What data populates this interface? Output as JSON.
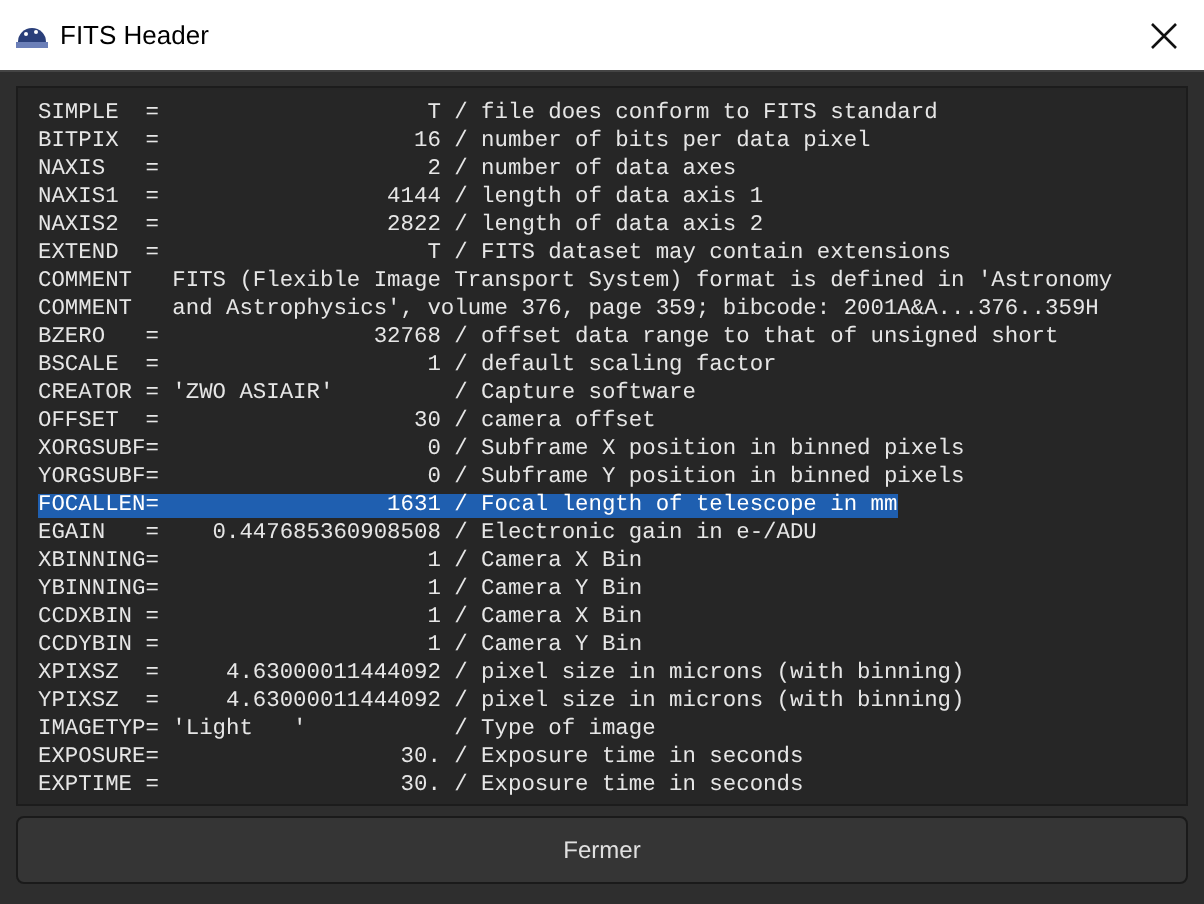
{
  "window": {
    "title": "FITS Header"
  },
  "lines": [
    {
      "text": "SIMPLE  =                    T / file does conform to FITS standard",
      "selected": false
    },
    {
      "text": "BITPIX  =                   16 / number of bits per data pixel",
      "selected": false
    },
    {
      "text": "NAXIS   =                    2 / number of data axes",
      "selected": false
    },
    {
      "text": "NAXIS1  =                 4144 / length of data axis 1",
      "selected": false
    },
    {
      "text": "NAXIS2  =                 2822 / length of data axis 2",
      "selected": false
    },
    {
      "text": "EXTEND  =                    T / FITS dataset may contain extensions",
      "selected": false
    },
    {
      "text": "COMMENT   FITS (Flexible Image Transport System) format is defined in 'Astronomy",
      "selected": false
    },
    {
      "text": "COMMENT   and Astrophysics', volume 376, page 359; bibcode: 2001A&A...376..359H",
      "selected": false
    },
    {
      "text": "BZERO   =                32768 / offset data range to that of unsigned short",
      "selected": false
    },
    {
      "text": "BSCALE  =                    1 / default scaling factor",
      "selected": false
    },
    {
      "text": "CREATOR = 'ZWO ASIAIR'         / Capture software",
      "selected": false
    },
    {
      "text": "OFFSET  =                   30 / camera offset",
      "selected": false
    },
    {
      "text": "XORGSUBF=                    0 / Subframe X position in binned pixels",
      "selected": false
    },
    {
      "text": "YORGSUBF=                    0 / Subframe Y position in binned pixels",
      "selected": false
    },
    {
      "text": "FOCALLEN=                 1631 / Focal length of telescope in mm",
      "selected": true
    },
    {
      "text": "EGAIN   =    0.447685360908508 / Electronic gain in e-/ADU",
      "selected": false
    },
    {
      "text": "XBINNING=                    1 / Camera X Bin",
      "selected": false
    },
    {
      "text": "YBINNING=                    1 / Camera Y Bin",
      "selected": false
    },
    {
      "text": "CCDXBIN =                    1 / Camera X Bin",
      "selected": false
    },
    {
      "text": "CCDYBIN =                    1 / Camera Y Bin",
      "selected": false
    },
    {
      "text": "XPIXSZ  =     4.63000011444092 / pixel size in microns (with binning)",
      "selected": false
    },
    {
      "text": "YPIXSZ  =     4.63000011444092 / pixel size in microns (with binning)",
      "selected": false
    },
    {
      "text": "IMAGETYP= 'Light   '           / Type of image",
      "selected": false
    },
    {
      "text": "EXPOSURE=                  30. / Exposure time in seconds",
      "selected": false
    },
    {
      "text": "EXPTIME =                  30. / Exposure time in seconds",
      "selected": false
    }
  ],
  "buttons": [
    {
      "label": "Fermer"
    }
  ]
}
